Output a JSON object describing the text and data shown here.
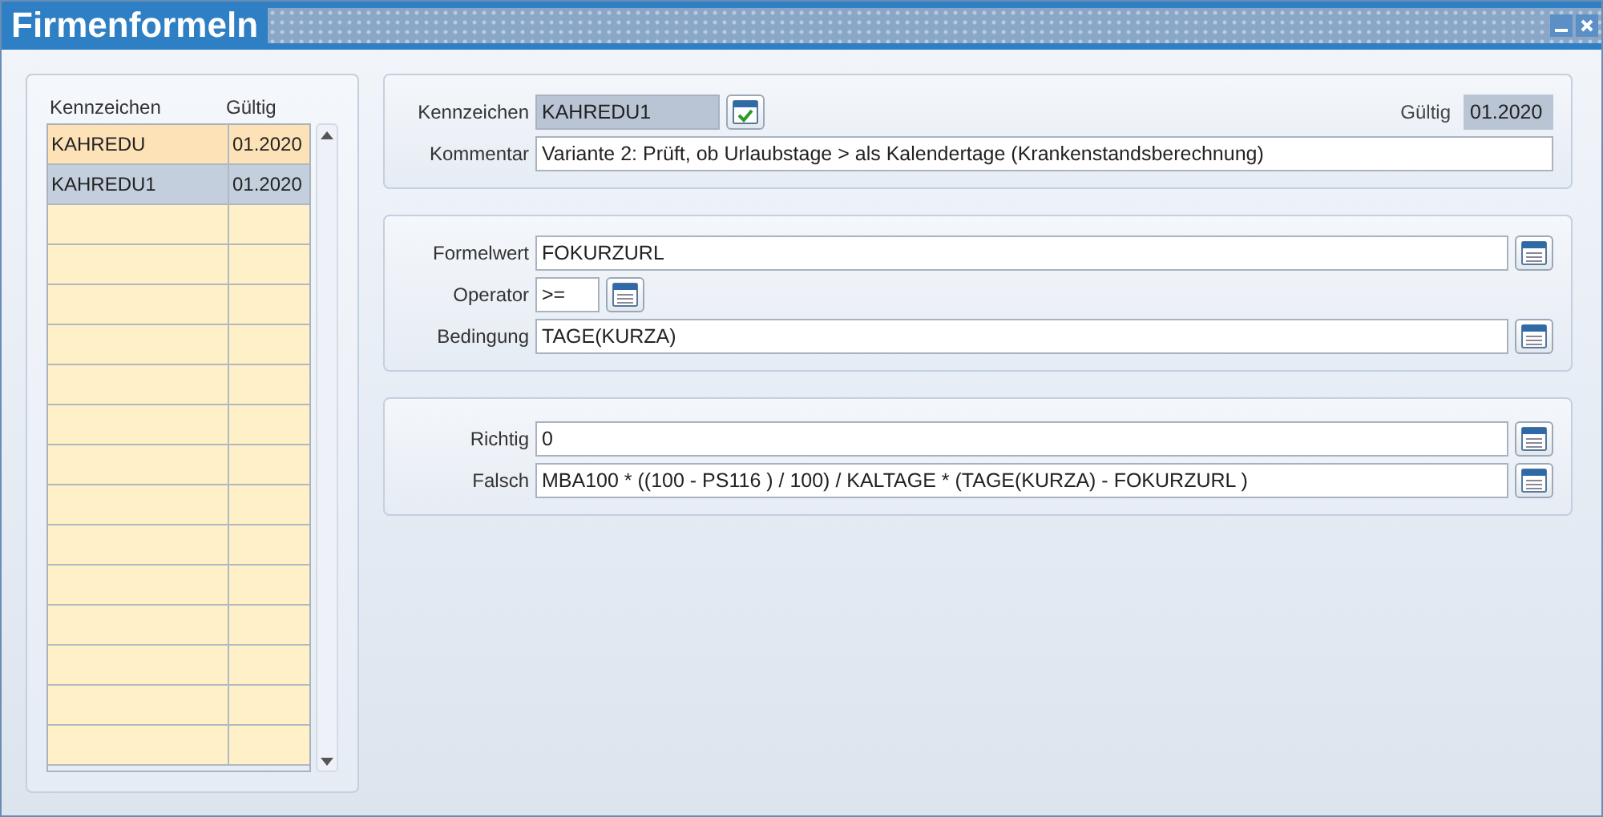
{
  "window": {
    "title": "Firmenformeln"
  },
  "list": {
    "columns": [
      "Kennzeichen",
      "Gültig"
    ],
    "rows": [
      {
        "cells": [
          "KAHREDU",
          "01.2020"
        ],
        "selected": false
      },
      {
        "cells": [
          "KAHREDU1",
          "01.2020"
        ],
        "selected": true
      }
    ]
  },
  "header": {
    "kennzeichen_label": "Kennzeichen",
    "kennzeichen": "KAHREDU1",
    "gueltig_label": "Gültig",
    "gueltig": "01.2020",
    "kommentar_label": "Kommentar",
    "kommentar": "Variante 2: Prüft, ob Urlaubstage > als Kalendertage (Krankenstandsberechnung)"
  },
  "condition": [
    {
      "label": "Formelwert",
      "value": "FOKURZURL",
      "kind": "wide"
    },
    {
      "label": "Operator",
      "value": ">=",
      "kind": "short"
    },
    {
      "label": "Bedingung",
      "value": "TAGE(KURZA)",
      "kind": "wide"
    }
  ],
  "result": [
    {
      "label": "Richtig",
      "value": "0",
      "kind": "wide"
    },
    {
      "label": "Falsch",
      "value": "MBA100 * ((100 - PS116 ) / 100) / KALTAGE * (TAGE(KURZA) - FOKURZURL )",
      "kind": "wide"
    }
  ]
}
